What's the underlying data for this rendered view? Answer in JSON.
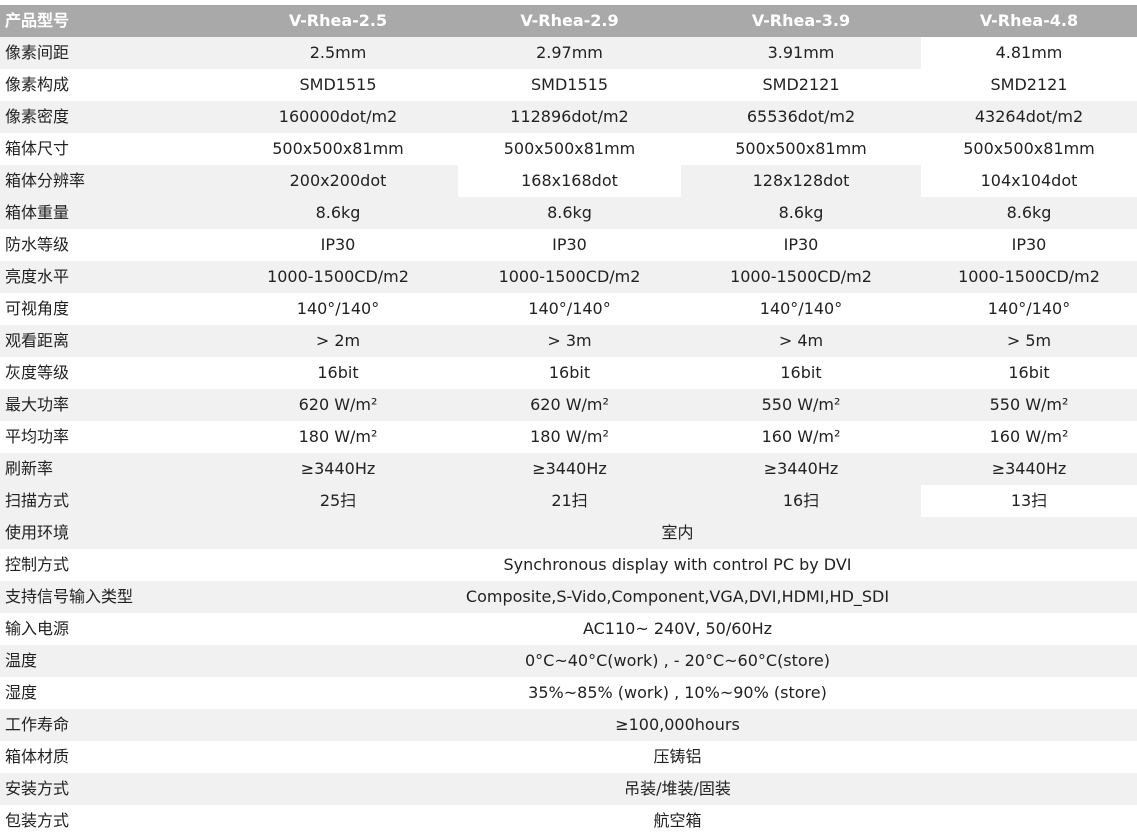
{
  "header": {
    "label": "产品型号",
    "models": [
      "V-Rhea-2.5",
      "V-Rhea-2.9",
      "V-Rhea-3.9",
      "V-Rhea-4.8"
    ]
  },
  "rows": [
    {
      "label": "像素间距",
      "values": [
        "2.5mm",
        "2.97mm",
        "3.91mm",
        "4.81mm"
      ]
    },
    {
      "label": "像素构成",
      "values": [
        "SMD1515",
        "SMD1515",
        "SMD2121",
        "SMD2121"
      ]
    },
    {
      "label": "像素密度",
      "values": [
        "160000dot/m2",
        "112896dot/m2",
        "65536dot/m2",
        "43264dot/m2"
      ]
    },
    {
      "label": "箱体尺寸",
      "values": [
        "500x500x81mm",
        "500x500x81mm",
        "500x500x81mm",
        "500x500x81mm"
      ]
    },
    {
      "label": "箱体分辨率",
      "values": [
        "200x200dot",
        "168x168dot",
        "128x128dot",
        "104x104dot"
      ]
    },
    {
      "label": "箱体重量",
      "values": [
        "8.6kg",
        "8.6kg",
        "8.6kg",
        "8.6kg"
      ]
    },
    {
      "label": "防水等级",
      "values": [
        "IP30",
        "IP30",
        "IP30",
        "IP30"
      ]
    },
    {
      "label": "亮度水平",
      "values": [
        "1000-1500CD/m2",
        "1000-1500CD/m2",
        "1000-1500CD/m2",
        "1000-1500CD/m2"
      ]
    },
    {
      "label": "可视角度",
      "values": [
        "140°/140°",
        "140°/140°",
        "140°/140°",
        "140°/140°"
      ]
    },
    {
      "label": "观看距离",
      "values": [
        "> 2m",
        "> 3m",
        "> 4m",
        "> 5m"
      ]
    },
    {
      "label": "灰度等级",
      "values": [
        "16bit",
        "16bit",
        "16bit",
        "16bit"
      ]
    },
    {
      "label": "最大功率",
      "values": [
        "620 W/m²",
        "620 W/m²",
        "550 W/m²",
        "550 W/m²"
      ]
    },
    {
      "label": "平均功率",
      "values": [
        "180 W/m²",
        "180 W/m²",
        "160 W/m²",
        "160 W/m²"
      ]
    },
    {
      "label": "刷新率",
      "values": [
        "≥3440Hz",
        "≥3440Hz",
        "≥3440Hz",
        "≥3440Hz"
      ]
    },
    {
      "label": "扫描方式",
      "values": [
        "25扫",
        "21扫",
        "16扫",
        "13扫"
      ]
    }
  ],
  "common_rows": [
    {
      "label": "使用环境",
      "value": "室内"
    },
    {
      "label": "控制方式",
      "value": "Synchronous display with control PC by DVI"
    },
    {
      "label": "支持信号输入类型",
      "value": "Composite,S-Vido,Component,VGA,DVI,HDMI,HD_SDI"
    },
    {
      "label": "输入电源",
      "value": "AC110~ 240V,  50/60Hz"
    },
    {
      "label": "温度",
      "value": "0°C~40°C(work) , - 20°C~60°C(store)"
    },
    {
      "label": "湿度",
      "value": "35%~85% (work) , 10%~90% (store)"
    },
    {
      "label": "工作寿命",
      "value": "≥100,000hours"
    },
    {
      "label": "箱体材质",
      "value": "压铸铝"
    },
    {
      "label": "安装方式",
      "value": "吊装/堆装/固装"
    },
    {
      "label": "包装方式",
      "value": "航空箱"
    }
  ],
  "colors": {
    "header_bg": "#a9a9a9",
    "header_text": "#ffffff",
    "stripe_bg": "#f1f1f1",
    "text": "#222222"
  }
}
